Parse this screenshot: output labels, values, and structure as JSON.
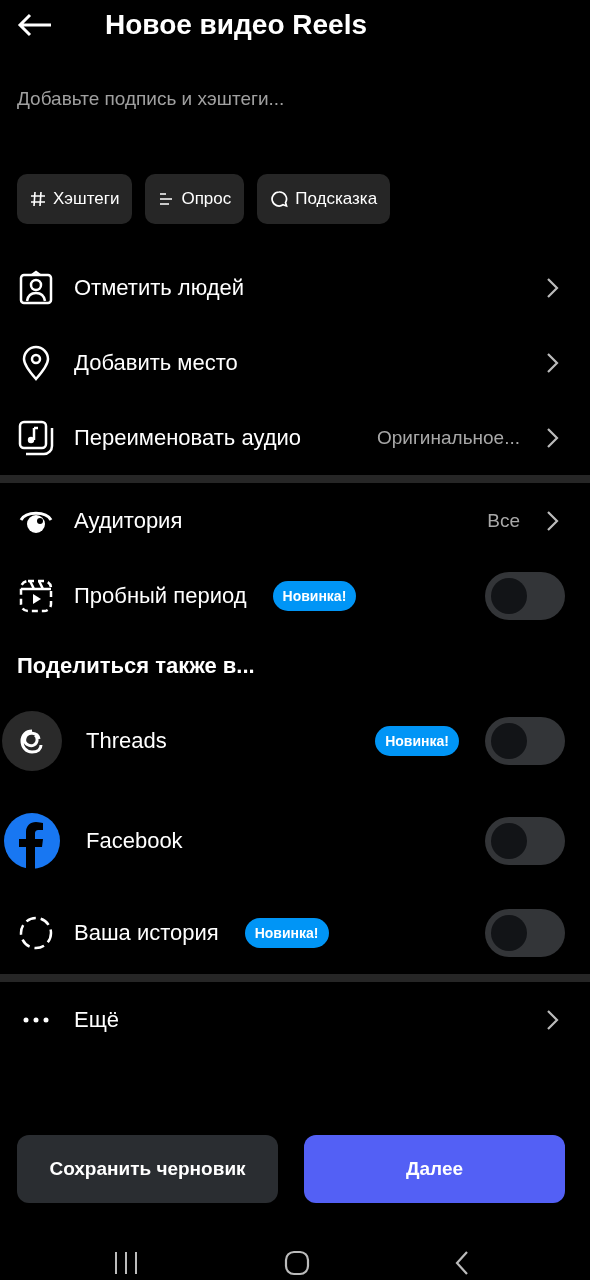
{
  "header": {
    "title": "Новое видео Reels"
  },
  "caption": {
    "placeholder": "Добавьте подпись и хэштеги..."
  },
  "chips": [
    {
      "label": "Хэштеги"
    },
    {
      "label": "Опрос"
    },
    {
      "label": "Подсказка"
    }
  ],
  "main_rows": [
    {
      "label": "Отметить людей"
    },
    {
      "label": "Добавить место"
    },
    {
      "label": "Переименовать аудио",
      "value": "Оригинальное..."
    }
  ],
  "audience_rows": [
    {
      "kind": "link",
      "label": "Аудитория",
      "value": "Все"
    },
    {
      "kind": "toggle",
      "label": "Пробный период",
      "badge": "Новинка!",
      "on": false
    }
  ],
  "share_section": {
    "heading": "Поделиться также в...",
    "rows": [
      {
        "label": "Threads",
        "badge": "Новинка!",
        "on": false
      },
      {
        "label": "Facebook",
        "on": false
      },
      {
        "label": "Ваша история",
        "badge": "Новинка!",
        "on": false
      }
    ]
  },
  "more_row": {
    "label": "Ещё"
  },
  "buttons": {
    "secondary": "Сохранить черновик",
    "primary": "Далее"
  }
}
